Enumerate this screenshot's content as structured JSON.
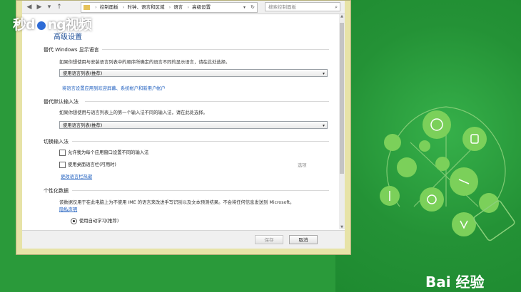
{
  "watermark": {
    "top_prefix": "秒d",
    "top_suffix": "ng视频",
    "bottom": "Bai 经验"
  },
  "address_bar": {
    "segments": [
      "控制面板",
      "时钟、语言和区域",
      "语言",
      "高级设置"
    ],
    "search_placeholder": "搜索控制面板"
  },
  "page": {
    "title": "高级设置"
  },
  "sections": {
    "display_language": {
      "title": "替代 Windows 显示语言",
      "description": "如果你想使用与安装语言列表中的顺序所确定的语言不同的显示语言，请在此处选择。",
      "select_value": "使用语言列表(推荐)",
      "link": "将语言设置应用到欢迎屏幕、系统帐户和新用户帐户"
    },
    "input_method": {
      "title": "替代默认输入法",
      "description": "如果你想使用与语言列表上的第一个输入法不同的输入法，请在此处选择。",
      "select_value": "使用语言列表(推荐)"
    },
    "switch_input": {
      "title": "切换输入法",
      "checkbox1": "允许我为每个应用窗口设置不同的输入法",
      "checkbox2": "使用桌面语言栏(可用时)",
      "options": "选项",
      "link": "更改语言栏热键"
    },
    "personalization": {
      "title": "个性化数据",
      "description": "该数据仅用于在此电脑上为不使用 IME 的语言来改进手写识别以及文本预测结果。不会将任何信息发送到 Microsoft。",
      "privacy_link": "隐私声明",
      "radio_label": "使用自动学习(推荐)"
    }
  },
  "footer": {
    "save": "保存",
    "cancel": "取消"
  },
  "colors": {
    "background": "#2a9a3a",
    "link": "#1f5fbf",
    "title": "#1e4f98"
  }
}
